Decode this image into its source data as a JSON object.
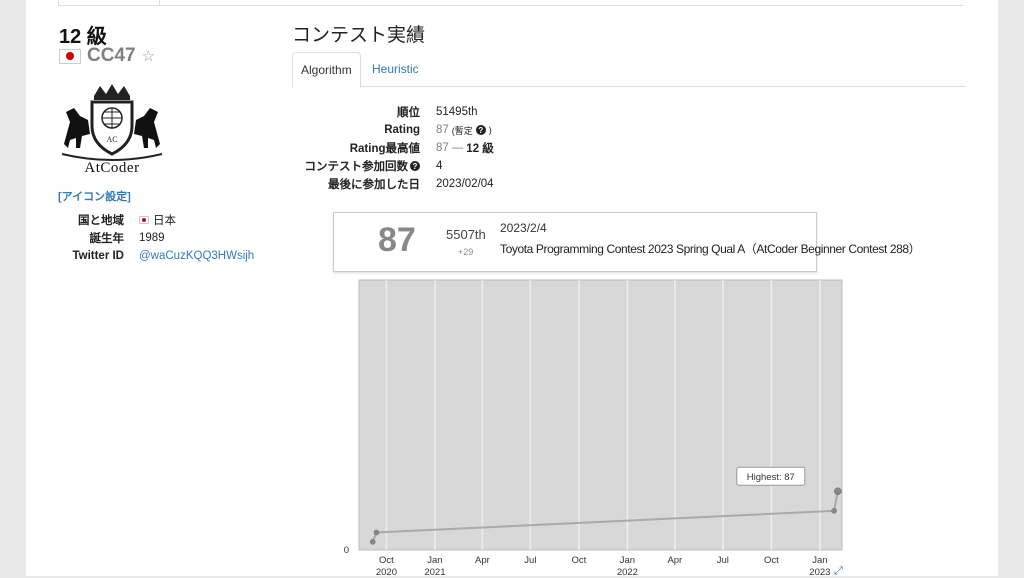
{
  "profile": {
    "rank_label": "12 級",
    "username": "CC47",
    "logo_text": "AtCoder",
    "icon_setting_link": "[アイコン設定]",
    "info": [
      {
        "key": "国と地域",
        "value": "日本",
        "flag": true
      },
      {
        "key": "誕生年",
        "value": "1989"
      },
      {
        "key": "Twitter ID",
        "value": "@waCuzKQQ3HWsijh",
        "link": true
      }
    ]
  },
  "history": {
    "title": "コンテスト実績",
    "tabs": [
      {
        "label": "Algorithm",
        "active": true
      },
      {
        "label": "Heuristic",
        "active": false
      }
    ],
    "stats": {
      "rank_label": "順位",
      "rank_value": "51495th",
      "rating_label": "Rating",
      "rating_value": "87",
      "rating_note": "(暫定",
      "highest_label": "Rating最高値",
      "highest_value": "87",
      "highest_sep": "—",
      "highest_kyu": "12 級",
      "count_label": "コンテスト参加回数",
      "count_value": "4",
      "last_label": "最後に参加した日",
      "last_value": "2023/02/04"
    }
  },
  "detail_box": {
    "rating": "87",
    "place": "5507th",
    "diff": "+29",
    "date": "2023/2/4",
    "contest": "Toyota Programming Contest 2023 Spring Qual A（AtCoder Beginner Contest 288）"
  },
  "chart_data": {
    "type": "line",
    "y_axis_ticks": [
      "0"
    ],
    "x_ticks": [
      {
        "label": "Oct",
        "year": "2020"
      },
      {
        "label": "Jan",
        "year": "2021"
      },
      {
        "label": "Apr",
        "year": ""
      },
      {
        "label": "Jul",
        "year": ""
      },
      {
        "label": "Oct",
        "year": ""
      },
      {
        "label": "Jan",
        "year": "2022"
      },
      {
        "label": "Apr",
        "year": ""
      },
      {
        "label": "Jul",
        "year": ""
      },
      {
        "label": "Oct",
        "year": ""
      },
      {
        "label": "Jan",
        "year": "2023"
      }
    ],
    "series": [
      {
        "values": [
          {
            "date": "2020-09-05",
            "rating": 12
          },
          {
            "date": "2020-09-12",
            "rating": 26
          },
          {
            "date": "2023-01-28",
            "rating": 58
          },
          {
            "date": "2023-02-04",
            "rating": 87
          }
        ]
      }
    ],
    "annotation": "Highest: 87",
    "colors": {
      "background": "#d8d8d8",
      "line": "#aaaaaa",
      "point": "#888888"
    }
  }
}
